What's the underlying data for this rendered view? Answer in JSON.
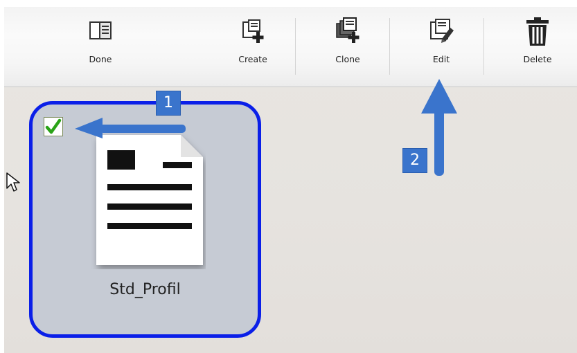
{
  "toolbar": {
    "done_label": "Done",
    "create_label": "Create",
    "clone_label": "Clone",
    "edit_label": "Edit",
    "delete_label": "Delete"
  },
  "profile_tile": {
    "name": "Std_Profil",
    "selected": true
  },
  "annotations": {
    "step1": "1",
    "step2": "2"
  },
  "colors": {
    "selection_border": "#0a1fe8",
    "tile_background": "#c6cbd4",
    "annotation_blue": "#3a74cc",
    "checkmark_green": "#2aa317"
  },
  "icons": [
    "done-icon",
    "create-icon",
    "clone-icon",
    "edit-icon",
    "trash-icon",
    "checkmark-icon",
    "document-icon",
    "mouse-cursor-icon"
  ]
}
